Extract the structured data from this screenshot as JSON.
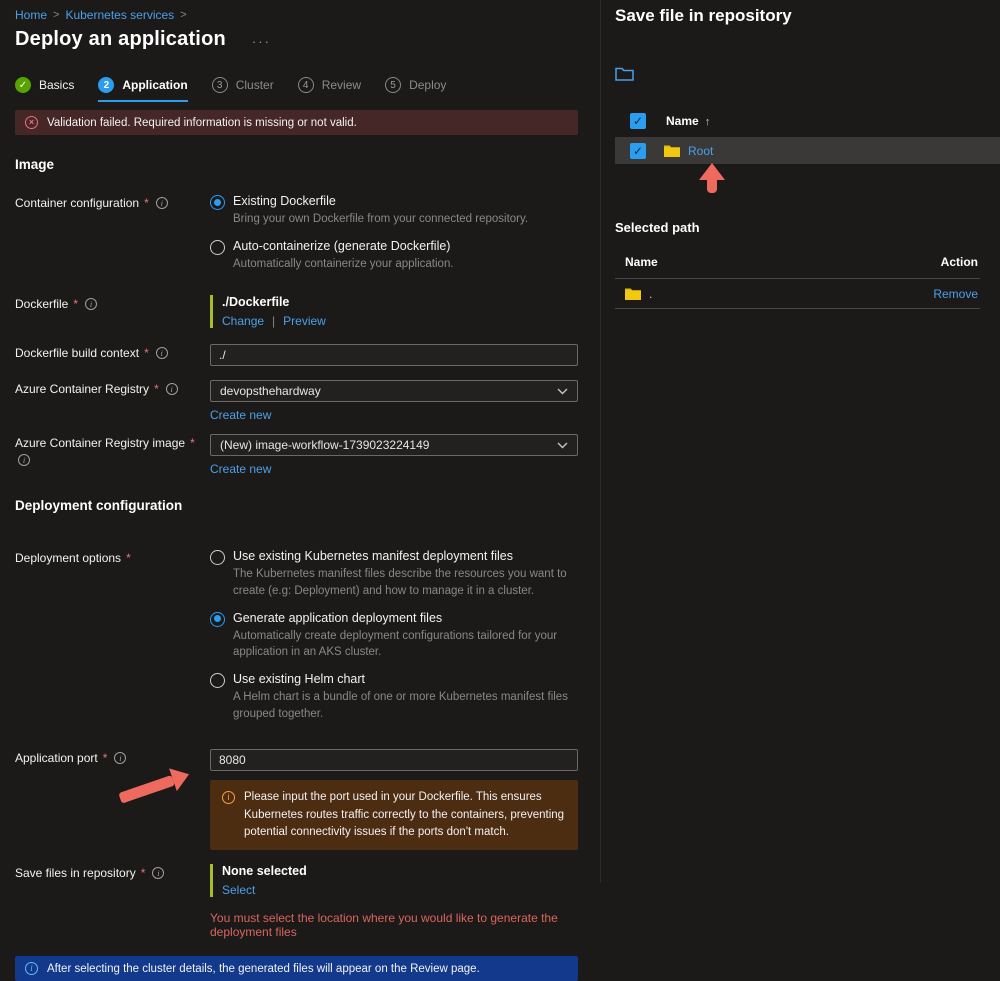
{
  "ui": {
    "required_marker": "*",
    "breadcrumb_separator": ">",
    "link_separator": "|",
    "more_label": "···",
    "check_glyph": "✓",
    "x_glyph": "×",
    "info_glyph": "i",
    "sort_indicator": "↑"
  },
  "colors": {
    "accent_blue": "#2b9df0",
    "link_blue": "#4ba0e8",
    "error_red": "#f1707b",
    "error_banner_bg": "#442726",
    "warning_bg": "#4c2d12",
    "warning_orange": "#ff9d3c",
    "info_banner_bg": "#12398b",
    "green_border": "#a9bd28",
    "arrow_salmon": "#ef6a5e",
    "folder_yellow": "#f2c811",
    "done_green": "#57a300",
    "row_highlight": "#3a3938",
    "validation_text_red": "#d9655f"
  },
  "breadcrumb": {
    "items": [
      "Home",
      "Kubernetes services"
    ]
  },
  "page": {
    "title": "Deploy an application"
  },
  "tabs": [
    {
      "label": "Basics",
      "state": "done"
    },
    {
      "label": "Application",
      "number": "2",
      "state": "active"
    },
    {
      "label": "Cluster",
      "number": "3",
      "state": "upcoming"
    },
    {
      "label": "Review",
      "number": "4",
      "state": "upcoming"
    },
    {
      "label": "Deploy",
      "number": "5",
      "state": "upcoming"
    }
  ],
  "error_banner": {
    "text": "Validation failed. Required information is missing or not valid."
  },
  "image_section": {
    "heading": "Image",
    "container_config": {
      "label": "Container configuration",
      "options": [
        {
          "label": "Existing Dockerfile",
          "desc": "Bring your own Dockerfile from your connected repository.",
          "selected": true
        },
        {
          "label": "Auto-containerize (generate Dockerfile)",
          "desc": "Automatically containerize your application.",
          "selected": false
        }
      ]
    },
    "dockerfile": {
      "label": "Dockerfile",
      "value": "./Dockerfile",
      "change_link": "Change",
      "preview_link": "Preview"
    },
    "build_context": {
      "label": "Dockerfile build context",
      "value": "./"
    },
    "acr": {
      "label": "Azure Container Registry",
      "value": "devopsthehardway",
      "create_link": "Create new"
    },
    "acr_image": {
      "label": "Azure Container Registry image",
      "value": "(New) image-workflow-1739023224149",
      "create_link": "Create new"
    }
  },
  "deployment_section": {
    "heading": "Deployment configuration",
    "options_label": "Deployment options",
    "options": [
      {
        "label": "Use existing Kubernetes manifest deployment files",
        "desc": "The Kubernetes manifest files describe the resources you want to create (e.g: Deployment) and how to manage it in a cluster.",
        "selected": false
      },
      {
        "label": "Generate application deployment files",
        "desc": "Automatically create deployment configurations tailored for your application in an AKS cluster.",
        "selected": true
      },
      {
        "label": "Use existing Helm chart",
        "desc": "A Helm chart is a bundle of one or more Kubernetes manifest files grouped together.",
        "selected": false
      }
    ],
    "app_port": {
      "label": "Application port",
      "value": "8080",
      "warning": "Please input the port used in your Dockerfile. This ensures Kubernetes routes traffic correctly to the containers, preventing potential connectivity issues if the ports don't match."
    },
    "save_files": {
      "label": "Save files in repository",
      "status": "None selected",
      "select_link": "Select",
      "error": "You must select the location where you would like to generate the deployment files"
    }
  },
  "info_banner": {
    "text": "After selecting the cluster details, the generated files will appear on the Review page."
  },
  "right_panel": {
    "title": "Save file in repository",
    "tree": {
      "name_header": "Name",
      "rows": [
        {
          "name": "Root",
          "checked": true
        }
      ]
    },
    "selected_path": {
      "heading": "Selected path",
      "name_header": "Name",
      "action_header": "Action",
      "rows": [
        {
          "name": ".",
          "action": "Remove"
        }
      ]
    }
  }
}
